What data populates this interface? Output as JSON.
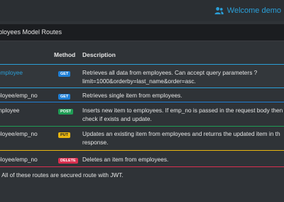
{
  "header": {
    "welcome_text": "Welcome demo",
    "accent": "#2a9fd8"
  },
  "page": {
    "title": "ployees Model Routes"
  },
  "table": {
    "columns": [
      "",
      "Method",
      "Description"
    ],
    "rows": [
      {
        "route": "employee",
        "method": "GET",
        "desc_line1": "Retrieves all data from employees. Can accept query parameters ?",
        "desc_line2": "limit=1000&orderby=last_name&order=asc."
      },
      {
        "route": "ployee/emp_no",
        "method": "GET",
        "desc_line1": "Retrieves single item from employees.",
        "desc_line2": ""
      },
      {
        "route": "mployee",
        "method": "POST",
        "desc_line1": "Inserts new item to employees. If emp_no is passed in the request body then",
        "desc_line2": "check if exists and update."
      },
      {
        "route": "ployee/emp_no",
        "method": "PUT",
        "desc_line1": "Updates an existing item from employees and returns the updated item in th",
        "desc_line2": "response."
      },
      {
        "route": "ployee/emp_no",
        "method": "DELETE",
        "desc_line1": "Deletes an item from employees.",
        "desc_line2": ""
      }
    ]
  },
  "note": ": All of these routes are secured route with JWT.",
  "colors": {
    "get": "#1e7fd6",
    "post": "#1f9d55",
    "put": "#e8b611",
    "delete": "#d9304f"
  }
}
